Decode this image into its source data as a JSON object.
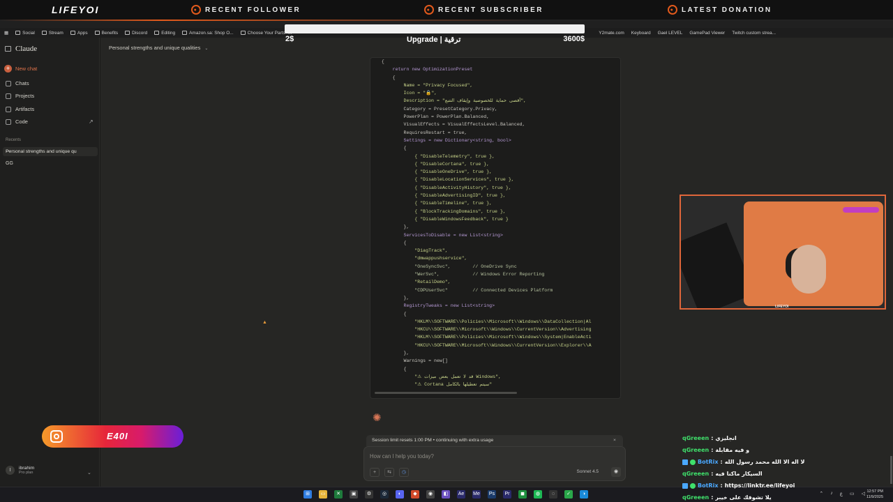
{
  "overlay": {
    "logo": "LIFEYOI",
    "follower": "RECENT FOLLOWER",
    "subscriber": "RECENT SUBSCRIBER",
    "donation": "LATEST DONATION",
    "donation_left": "2$",
    "donation_center": "Upgrade | ترقية",
    "donation_right": "3600$"
  },
  "browser": {
    "url": "claude.ai/chat/..."
  },
  "bookmarks": [
    {
      "label": "Social"
    },
    {
      "label": "Stream"
    },
    {
      "label": "Apps"
    },
    {
      "label": "Benefits"
    },
    {
      "label": "Discord"
    },
    {
      "label": "Editing"
    },
    {
      "label": "Amazon.sa: Shop O..."
    },
    {
      "label": "Choose Your Parts -..."
    }
  ],
  "bookmarks_right": [
    {
      "label": "Y2mate.com"
    },
    {
      "label": "Keyboard"
    },
    {
      "label": "Gael LEVEL"
    },
    {
      "label": "GamePad Viewer"
    },
    {
      "label": "Twitch custom strea..."
    }
  ],
  "sidebar": {
    "app_title": "Claude",
    "new_chat": "New chat",
    "items": [
      {
        "label": "Chats"
      },
      {
        "label": "Projects"
      },
      {
        "label": "Artifacts"
      },
      {
        "label": "Code"
      }
    ],
    "recents_label": "Recents",
    "recent_active": "Personal strengths and unique qu",
    "recent_2": "GG",
    "user_name": "ibrahim",
    "user_plan": "Pro plan",
    "user_initial": "I"
  },
  "instagram": {
    "handle": "E40I"
  },
  "main": {
    "chat_title": "Personal strengths and unique qualities",
    "session_notice": "Session limit resets 1:00 PM • continuing with extra usage",
    "input_placeholder": "How can I help you today?",
    "model": "Sonnet 4.5"
  },
  "code": [
    "    {",
    "        return new OptimizationPreset",
    "        {",
    "            Name = \"Privacy Focused\",",
    "            Icon = \"🔒\",",
    "            Description = \"أقصى حماية للخصوصية وإيقاف التتبع\",",
    "            Category = PresetCategory.Privacy,",
    "            PowerPlan = PowerPlan.Balanced,",
    "            VisualEffects = VisualEffectsLevel.Balanced,",
    "            RequiresRestart = true,",
    "            Settings = new Dictionary<string, bool>",
    "            {",
    "                { \"DisableTelemetry\", true },",
    "                { \"DisableCortana\", true },",
    "                { \"DisableOneDrive\", true },",
    "                { \"DisableLocationServices\", true },",
    "                { \"DisableActivityHistory\", true },",
    "                { \"DisableAdvertisingID\", true },",
    "                { \"DisableTimeline\", true },",
    "                { \"BlockTrackingDomains\", true },",
    "                { \"DisableWindowsFeedback\", true }",
    "            },",
    "            ServicesToDisable = new List<string>",
    "            {",
    "                \"DiagTrack\",",
    "                \"dmwappushservice\",",
    "                \"OneSyncSvc\",        // OneDrive Sync",
    "                \"WerSvc\",            // Windows Error Reporting",
    "                \"RetailDemo\",",
    "                \"CDPUserSvc\"         // Connected Devices Platform",
    "            },",
    "            RegistryTweaks = new List<string>",
    "            {",
    "                \"HKLM\\\\SOFTWARE\\\\Policies\\\\Microsoft\\\\Windows\\\\DataCollection|Al",
    "                \"HKCU\\\\SOFTWARE\\\\Microsoft\\\\Windows\\\\CurrentVersion\\\\Advertising",
    "                \"HKLM\\\\SOFTWARE\\\\Policies\\\\Microsoft\\\\Windows\\\\System|EnableActi",
    "                \"HKCU\\\\SOFTWARE\\\\Microsoft\\\\Windows\\\\CurrentVersion\\\\Explorer\\\\A",
    "            },",
    "            Warnings = new[]",
    "            {",
    "                \"⚠ قد لا تعمل بعض ميزات Windows\",",
    "                \"⚠ Cortana سيتم تعطيلها بالكامل\""
  ],
  "cam": {
    "label": "LIFEYOI"
  },
  "chat_overlay": [
    {
      "user": "qGreeen",
      "msg": "انجليزي",
      "bot": false
    },
    {
      "user": "qGreeen",
      "msg": "و فيه مقابلة",
      "bot": false
    },
    {
      "user": "BotRix",
      "msg": "لا اله الا الله محمد رسول الله",
      "bot": true
    },
    {
      "user": "qGreeen",
      "msg": "السيكار ماكنا فيه",
      "bot": false
    },
    {
      "user": "BotRix",
      "msg": "https://linktr.ee/lifeyoi",
      "bot": true
    },
    {
      "user": "qGreeen",
      "msg": "يلا تشوفك على خيبر",
      "bot": false
    }
  ],
  "taskbar": {
    "time": "12:57 PM",
    "date": "11/9/2025",
    "lang": "ع"
  },
  "colors": {
    "accent": "#d97757",
    "overlay_orange": "#e25a1c",
    "chat_user": "#3fe06b",
    "bot_user": "#4aa8ff"
  }
}
